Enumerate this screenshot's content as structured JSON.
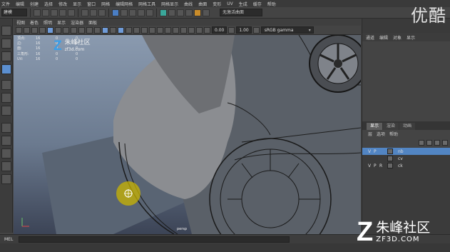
{
  "menubar": {
    "items": [
      "文件",
      "编辑",
      "创建",
      "选择",
      "修改",
      "显示",
      "窗口",
      "网格",
      "编辑网格",
      "网格工具",
      "网格显示",
      "曲线",
      "曲面",
      "变形",
      "UV",
      "生成",
      "缓存",
      "帮助"
    ]
  },
  "status_line": {
    "mode": "建模",
    "live_field": "无激活曲面"
  },
  "viewport_panel": {
    "menu": [
      "视图",
      "着色",
      "照明",
      "显示",
      "渲染器",
      "面板"
    ],
    "exposure": "0.00",
    "gamma": "1.00",
    "color_space": "sRGB gamma",
    "camera": "persp"
  },
  "hud": {
    "rows": [
      {
        "label": "顶点:",
        "a": "16",
        "b": "0",
        "c": "0"
      },
      {
        "label": "边:",
        "a": "16",
        "b": "0",
        "c": "0"
      },
      {
        "label": "面:",
        "a": "16",
        "b": "0",
        "c": "0"
      },
      {
        "label": "三角形:",
        "a": "16",
        "b": "0",
        "c": "0"
      },
      {
        "label": "UV:",
        "a": "16",
        "b": "0",
        "c": "0"
      }
    ]
  },
  "viewport_watermark": {
    "name": "朱峰社区",
    "sub": "zf3d.com"
  },
  "channel_box": {
    "menu": [
      "通道",
      "编辑",
      "对象",
      "显示"
    ]
  },
  "layer_editor": {
    "tabs": [
      "显示",
      "渲染",
      "动画"
    ],
    "active_tab": "显示",
    "menu": [
      "层",
      "选项",
      "帮助"
    ],
    "layers": [
      {
        "v": "V",
        "p": "P",
        "r": "",
        "name": "nb",
        "selected": true
      },
      {
        "v": "",
        "p": "",
        "r": "",
        "name": "cv",
        "selected": false
      },
      {
        "v": "V",
        "p": "P",
        "r": "R",
        "name": "ck",
        "selected": false
      }
    ]
  },
  "command_line": {
    "label": "MEL"
  },
  "help_line": {
    "text": ""
  },
  "overlays": {
    "youku": "优酷",
    "brand_name": "朱峰社区",
    "brand_site": "ZF3D.COM"
  },
  "colors": {
    "accent_blue": "#5285c3",
    "selection_yellow": "#c9b400",
    "brand_blue": "#3b9ee8"
  }
}
